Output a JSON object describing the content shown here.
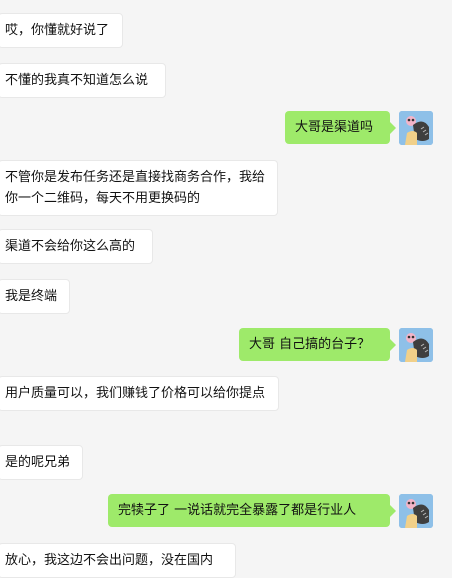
{
  "conversation": {
    "messages": [
      {
        "side": "in",
        "text": "哎，你懂就好说了"
      },
      {
        "side": "in",
        "text": "不懂的我真不知道怎么说"
      },
      {
        "side": "out",
        "text": "大哥是渠道吗"
      },
      {
        "side": "in",
        "text": "不管你是发布任务还是直接找商务合作，我给你一个二维码，每天不用更换码的"
      },
      {
        "side": "in",
        "text": "渠道不会给你这么高的"
      },
      {
        "side": "in",
        "text": "我是终端"
      },
      {
        "side": "out",
        "text": "大哥 自己搞的台子？"
      },
      {
        "side": "in",
        "text": "用户质量可以，我们赚钱了价格可以给你提点"
      },
      {
        "side": "in",
        "text": "是的呢兄弟"
      },
      {
        "side": "out",
        "text": "完犊子了  一说话就完全暴露了都是行业人"
      },
      {
        "side": "in",
        "text": "放心，我这边不会出问题，没在国内"
      }
    ]
  },
  "avatar": {
    "icon": "cartoon-avatar-icon",
    "bg_color": "#8ec0e8"
  },
  "colors": {
    "background": "#f5f5f5",
    "incoming_bubble": "#ffffff",
    "outgoing_bubble": "#9eea6a"
  }
}
